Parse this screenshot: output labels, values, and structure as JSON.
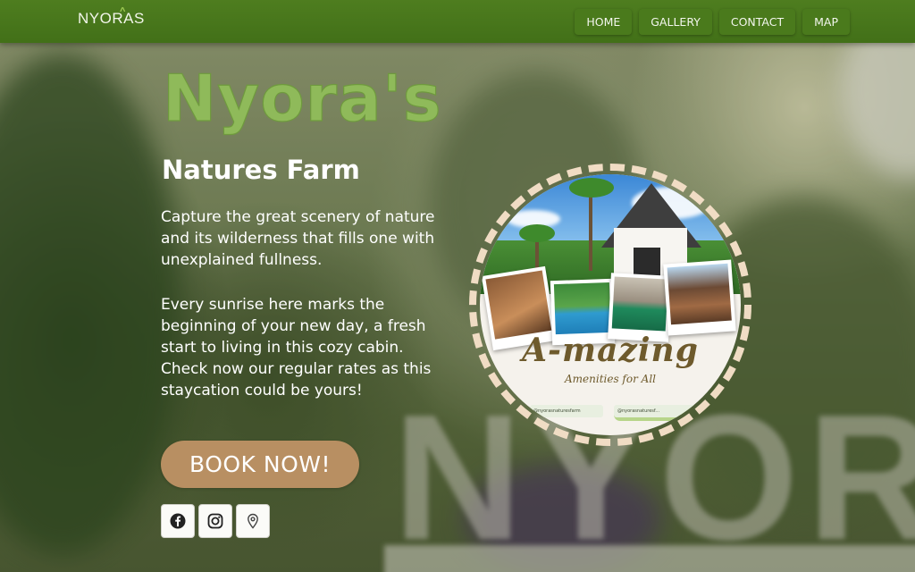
{
  "brand": {
    "logo_text": "NYORAS",
    "logo_mark": "^"
  },
  "nav": {
    "items": [
      {
        "label": "HOME"
      },
      {
        "label": "GALLERY"
      },
      {
        "label": "CONTACT"
      },
      {
        "label": "MAP"
      }
    ]
  },
  "hero": {
    "title": "Nyora's",
    "subtitle": "Natures Farm",
    "paragraph1": "Capture the great scenery of nature and its wilderness that fills one with unexplained fullness.",
    "paragraph2": "Every sunrise here marks the beginning of your new day, a fresh start to living in this cozy cabin. Check now our regular rates as this staycation could be yours!",
    "cta_label": "BOOK NOW!"
  },
  "social": {
    "icons": [
      "facebook-icon",
      "instagram-icon",
      "map-pin-icon"
    ]
  },
  "promo": {
    "headline": "A-mazing",
    "tagline": "Amenities for All",
    "handle_left": "@nyorasnaturesfarm",
    "handle_right": "@nyorasnaturesf..."
  },
  "background": {
    "sign_text": "NYORA"
  },
  "colors": {
    "nav_green": "#4a7a1c",
    "title_green": "#8fba5a",
    "cta_tan": "#b88f62",
    "ring_cream": "#f0dcc4"
  }
}
